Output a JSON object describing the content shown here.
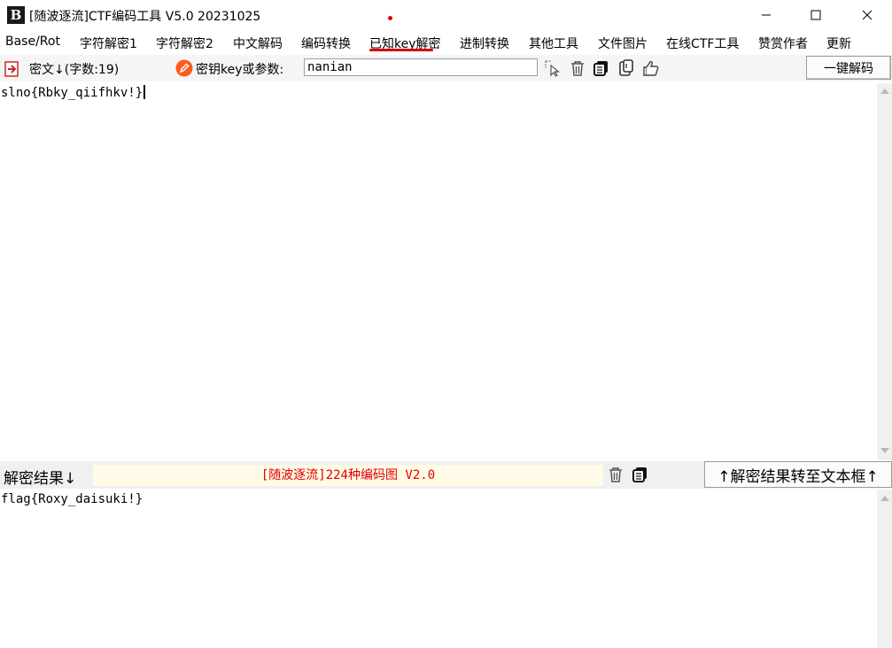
{
  "window": {
    "title": "[随波逐流]CTF编码工具 V5.0 20231025",
    "icon_letter": "B"
  },
  "menu": [
    "Base/Rot",
    "字符解密1",
    "字符解密2",
    "中文解码",
    "编码转换",
    "已知key解密",
    "进制转换",
    "其他工具",
    "文件图片",
    "在线CTF工具",
    "赞赏作者",
    "更新"
  ],
  "toolbar": {
    "cipher_label": "密文↓(字数:19)",
    "key_label": "密钥key或参数:",
    "key_value": "nanian",
    "onekey_button": "一键解码"
  },
  "cipher_text": "slno{Rbky_qiifhkv!}",
  "result_bar": {
    "label": "解密结果↓",
    "banner": "[随波逐流]224种编码图 V2.0",
    "transfer_button": "↑解密结果转至文本框↑"
  },
  "result_text": "flag{Roxy_daisuki!}",
  "colors": {
    "accent_red": "#e00000",
    "banner_bg": "#fffbe6",
    "key_icon_orange": "#ff5a1f"
  }
}
